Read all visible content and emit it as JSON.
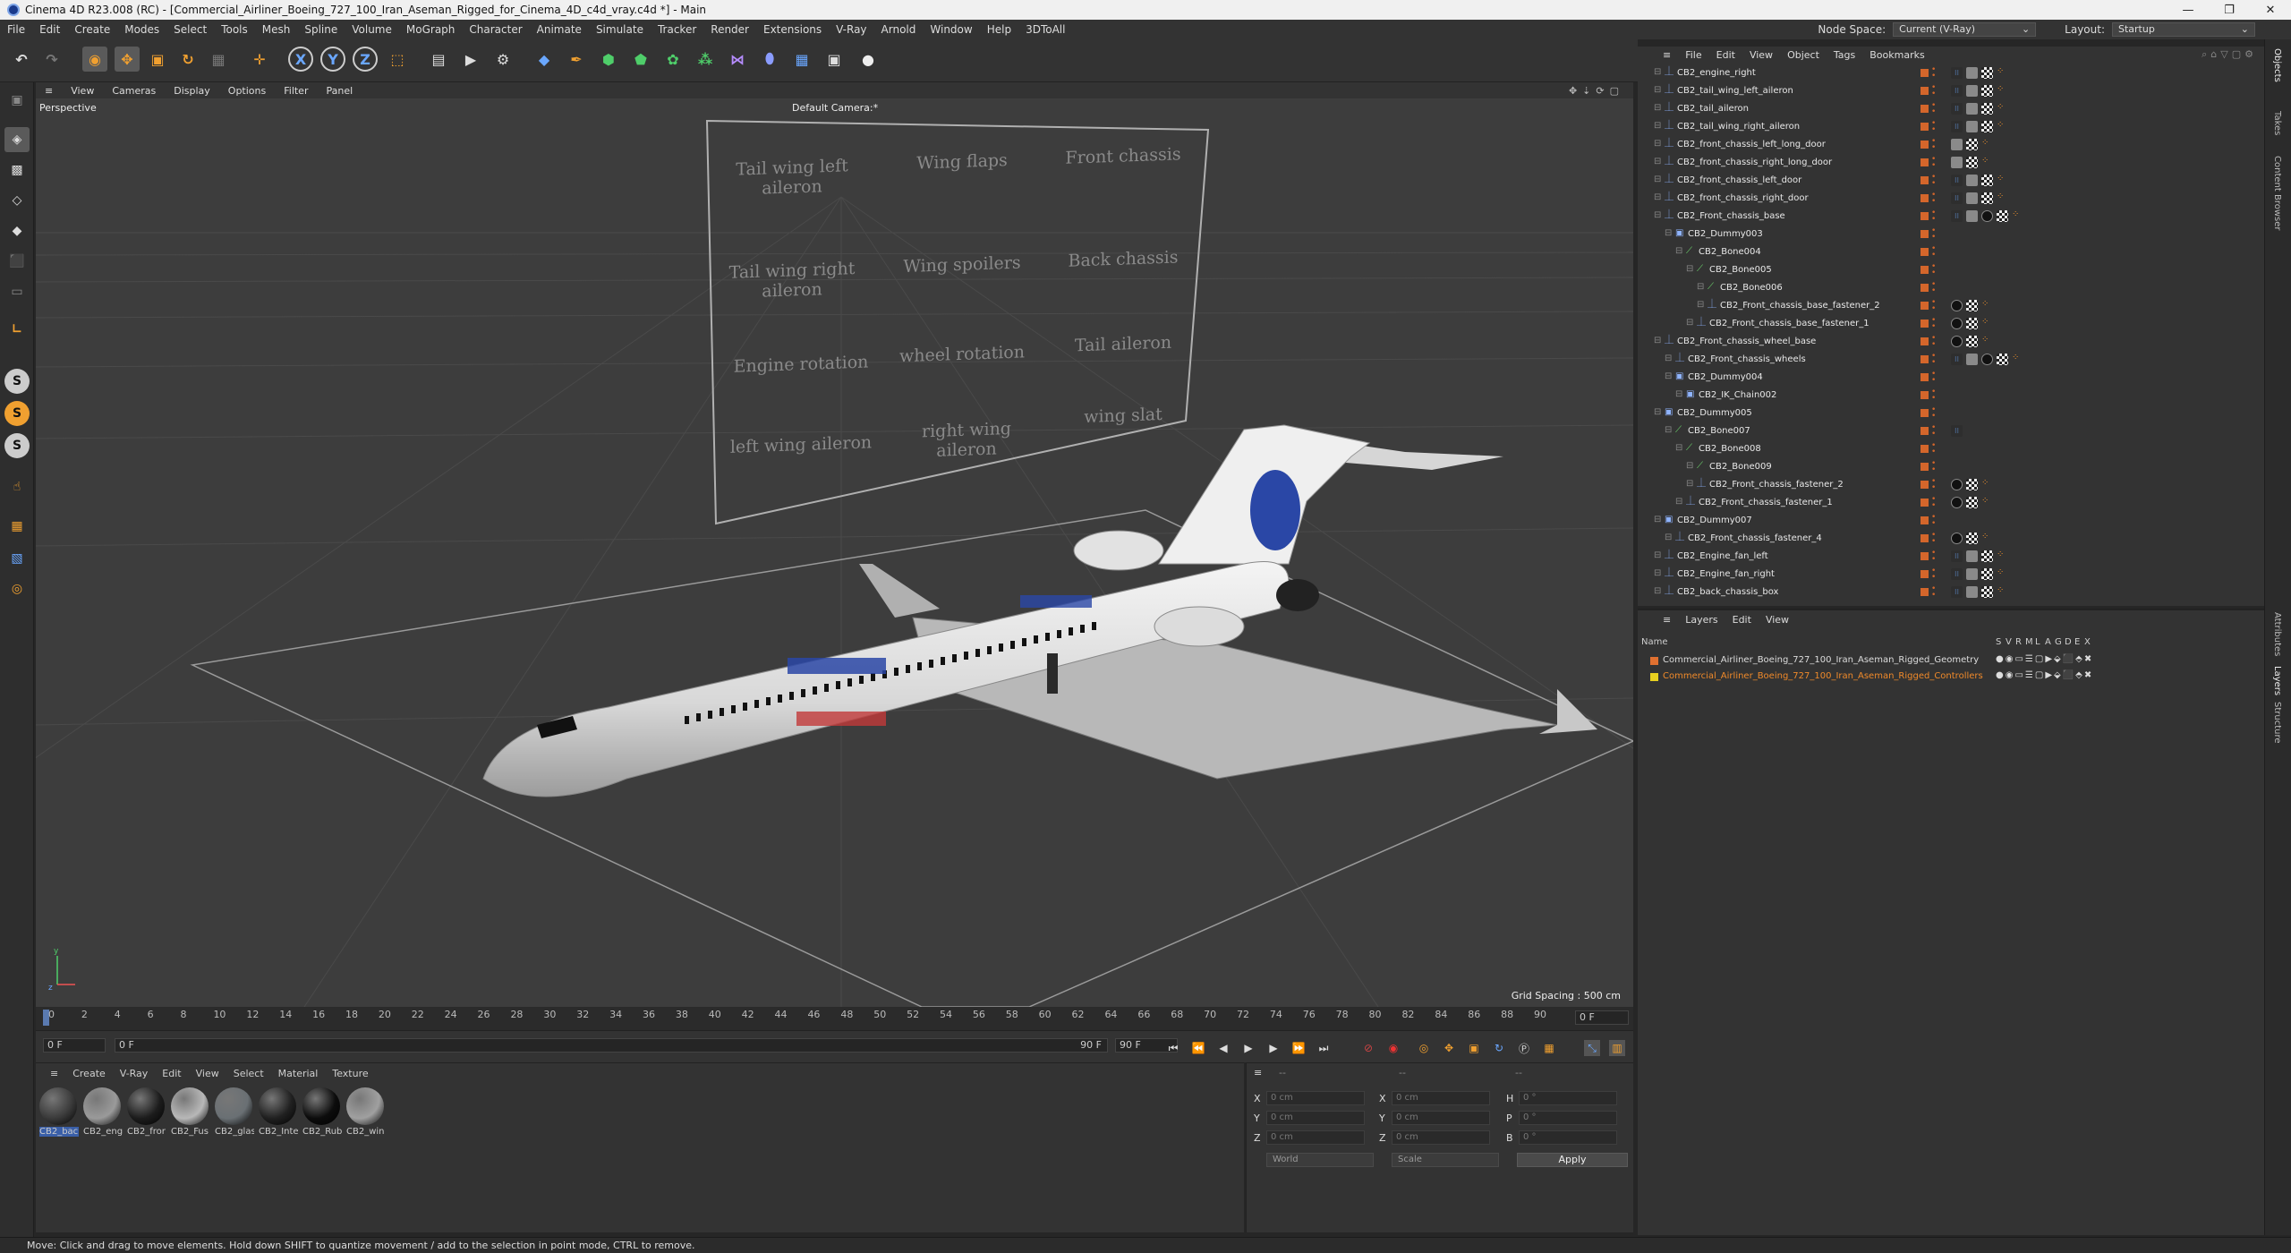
{
  "window": {
    "title": "Cinema 4D R23.008 (RC) - [Commercial_Airliner_Boeing_727_100_Iran_Aseman_Rigged_for_Cinema_4D_c4d_vray.c4d *] - Main",
    "minimize": "—",
    "restore": "❐",
    "close": "✕"
  },
  "menubar": {
    "items": [
      "File",
      "Edit",
      "Create",
      "Modes",
      "Select",
      "Tools",
      "Mesh",
      "Spline",
      "Volume",
      "MoGraph",
      "Character",
      "Animate",
      "Simulate",
      "Tracker",
      "Render",
      "Extensions",
      "V-Ray",
      "Arnold",
      "Window",
      "Help",
      "3DToAll"
    ],
    "node_space_label": "Node Space:",
    "node_space_value": "Current (V-Ray)",
    "layout_label": "Layout:",
    "layout_value": "Startup"
  },
  "viewport": {
    "menu": [
      "View",
      "Cameras",
      "Display",
      "Options",
      "Filter",
      "Panel"
    ],
    "label": "Perspective",
    "camera": "Default Camera",
    "camera_suffix": ":*",
    "grid_spacing": "Grid Spacing : 500 cm",
    "control_panel": [
      [
        "Tail wing left aileron",
        "Wing flaps",
        "Front chassis"
      ],
      [
        "Tail wing right aileron",
        "Wing spoilers",
        "Back chassis"
      ],
      [
        "Engine rotation",
        "wheel rotation",
        "Tail aileron"
      ],
      [
        "left wing aileron",
        "right wing aileron",
        "wing slat"
      ]
    ]
  },
  "timeline": {
    "ticks": [
      "0",
      "2",
      "4",
      "6",
      "8",
      "10",
      "12",
      "14",
      "16",
      "18",
      "20",
      "22",
      "24",
      "26",
      "28",
      "30",
      "32",
      "34",
      "36",
      "38",
      "40",
      "42",
      "44",
      "46",
      "48",
      "50",
      "52",
      "54",
      "56",
      "58",
      "60",
      "62",
      "64",
      "66",
      "68",
      "70",
      "72",
      "74",
      "76",
      "78",
      "80",
      "82",
      "84",
      "86",
      "88",
      "90"
    ],
    "current_frame": "0 F",
    "start": "0 F",
    "min": "0 F",
    "end_inner": "90 F",
    "end": "90 F"
  },
  "materials": {
    "menu": [
      "Create",
      "V-Ray",
      "Edit",
      "View",
      "Select",
      "Material",
      "Texture"
    ],
    "items": [
      {
        "label": "CB2_bac",
        "color": "#3a3a3a"
      },
      {
        "label": "CB2_eng",
        "color": "#9a9a9a"
      },
      {
        "label": "CB2_fror",
        "color": "#1c1c1c"
      },
      {
        "label": "CB2_Fus",
        "color": "#b8b8b8"
      },
      {
        "label": "CB2_glas",
        "color": "#6a7074"
      },
      {
        "label": "CB2_Inte",
        "color": "#202020"
      },
      {
        "label": "CB2_Rub",
        "color": "#0c0c0c"
      },
      {
        "label": "CB2_win",
        "color": "#a0a0a0"
      }
    ]
  },
  "coordinates": {
    "header_a": "--",
    "header_b": "--",
    "header_c": "--",
    "pos": [
      {
        "axis": "X",
        "value": "0 cm"
      },
      {
        "axis": "Y",
        "value": "0 cm"
      },
      {
        "axis": "Z",
        "value": "0 cm"
      }
    ],
    "size": [
      {
        "axis": "X",
        "value": "0 cm"
      },
      {
        "axis": "Y",
        "value": "0 cm"
      },
      {
        "axis": "Z",
        "value": "0 cm"
      }
    ],
    "rot": [
      {
        "axis": "H",
        "value": "0 °"
      },
      {
        "axis": "P",
        "value": "0 °"
      },
      {
        "axis": "B",
        "value": "0 °"
      }
    ],
    "mode": "World",
    "scale": "Scale",
    "apply": "Apply"
  },
  "status": "Move: Click and drag to move elements. Hold down SHIFT to quantize movement / add to the selection in point mode, CTRL to remove.",
  "object_manager": {
    "menu": [
      "File",
      "Edit",
      "View",
      "Object",
      "Tags",
      "Bookmarks"
    ],
    "rows": [
      {
        "name": "CB2_engine_right",
        "indent": 1,
        "tags": "vgcd"
      },
      {
        "name": "CB2_tail_wing_left_aileron",
        "indent": 1,
        "tags": "vgcd"
      },
      {
        "name": "CB2_tail_aileron",
        "indent": 1,
        "tags": "vgcd"
      },
      {
        "name": "CB2_tail_wing_right_aileron",
        "indent": 1,
        "tags": "vgcd"
      },
      {
        "name": "CB2_front_chassis_left_long_door",
        "indent": 1,
        "tags": "gcd"
      },
      {
        "name": "CB2_front_chassis_right_long_door",
        "indent": 1,
        "tags": "gcd"
      },
      {
        "name": "CB2_front_chassis_left_door",
        "indent": 1,
        "tags": "vgcd"
      },
      {
        "name": "CB2_front_chassis_right_door",
        "indent": 1,
        "tags": "vgcd"
      },
      {
        "name": "CB2_Front_chassis_base",
        "indent": 1,
        "tags": "vgbcd"
      },
      {
        "name": "CB2_Dummy003",
        "indent": 2,
        "tags": ""
      },
      {
        "name": "CB2_Bone004",
        "indent": 3,
        "tags": ""
      },
      {
        "name": "CB2_Bone005",
        "indent": 4,
        "tags": ""
      },
      {
        "name": "CB2_Bone006",
        "indent": 5,
        "tags": ""
      },
      {
        "name": "CB2_Front_chassis_base_fastener_2",
        "indent": 5,
        "tags": "bcd"
      },
      {
        "name": "CB2_Front_chassis_base_fastener_1",
        "indent": 4,
        "tags": "bcd"
      },
      {
        "name": "CB2_Front_chassis_wheel_base",
        "indent": 1,
        "tags": "bcd"
      },
      {
        "name": "CB2_Front_chassis_wheels",
        "indent": 2,
        "tags": "vgbcd"
      },
      {
        "name": "CB2_Dummy004",
        "indent": 2,
        "tags": ""
      },
      {
        "name": "CB2_IK_Chain002",
        "indent": 3,
        "tags": ""
      },
      {
        "name": "CB2_Dummy005",
        "indent": 1,
        "tags": ""
      },
      {
        "name": "CB2_Bone007",
        "indent": 2,
        "tags": "v"
      },
      {
        "name": "CB2_Bone008",
        "indent": 3,
        "tags": ""
      },
      {
        "name": "CB2_Bone009",
        "indent": 4,
        "tags": ""
      },
      {
        "name": "CB2_Front_chassis_fastener_2",
        "indent": 4,
        "tags": "bcd"
      },
      {
        "name": "CB2_Front_chassis_fastener_1",
        "indent": 3,
        "tags": "bcd"
      },
      {
        "name": "CB2_Dummy007",
        "indent": 1,
        "tags": ""
      },
      {
        "name": "CB2_Front_chassis_fastener_4",
        "indent": 2,
        "tags": "bcd"
      },
      {
        "name": "CB2_Engine_fan_left",
        "indent": 1,
        "tags": "vgcd"
      },
      {
        "name": "CB2_Engine_fan_right",
        "indent": 1,
        "tags": "vgcd"
      },
      {
        "name": "CB2_back_chassis_box",
        "indent": 1,
        "tags": "vgcd"
      }
    ]
  },
  "layers": {
    "menu": [
      "Layers",
      "Edit",
      "View"
    ],
    "name_header": "Name",
    "column_headers": [
      "S",
      "V",
      "R",
      "M",
      "L",
      "A",
      "G",
      "D",
      "E",
      "X"
    ],
    "rows": [
      {
        "name": "Commercial_Airliner_Boeing_727_100_Iran_Aseman_Rigged_Geometry",
        "color": "#e07030",
        "text_color": "#dddddd"
      },
      {
        "name": "Commercial_Airliner_Boeing_727_100_Iran_Aseman_Rigged_Controllers",
        "color": "#e8d020",
        "text_color": "#f08a2a"
      }
    ]
  },
  "vertical_tabs": [
    "Objects",
    "Takes",
    "Content Browser",
    "Attributes",
    "Layers",
    "Structure"
  ],
  "colors": {
    "accent": "#e07030",
    "selected": "#5a5a5a",
    "viewport": "#3d3d3d"
  }
}
